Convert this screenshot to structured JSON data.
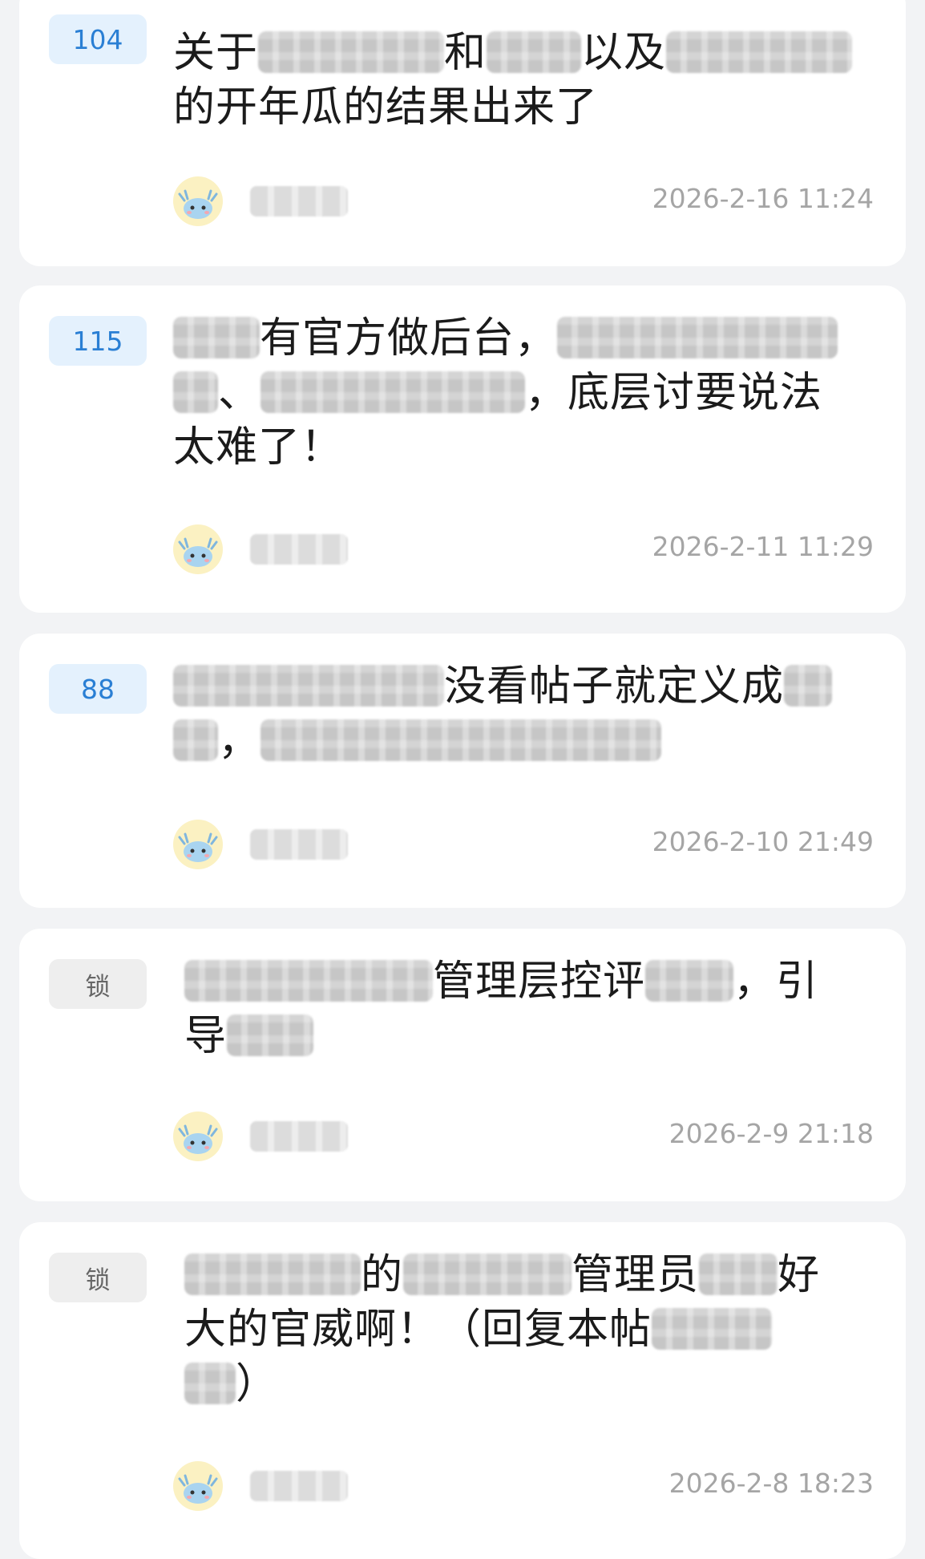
{
  "posts": [
    {
      "badge": "104",
      "badge_type": "count",
      "title_parts": [
        "关于",
        "和",
        "以及",
        "的开年瓜的结果出来了"
      ],
      "time": "2026-2-16 11:24"
    },
    {
      "badge": "115",
      "badge_type": "count",
      "title_parts": [
        "有官方做后台，",
        "，底层讨要说法",
        "太难了！"
      ],
      "time": "2026-2-11 11:29"
    },
    {
      "badge": "88",
      "badge_type": "count",
      "title_parts": [
        "没看帖子就定义成",
        "，"
      ],
      "time": "2026-2-10 21:49"
    },
    {
      "badge": "锁",
      "badge_type": "lock",
      "title_parts": [
        "管理层控评",
        "，引",
        "导"
      ],
      "time": "2026-2-9 21:18"
    },
    {
      "badge": "锁",
      "badge_type": "lock",
      "title_parts": [
        "的",
        "管理员",
        "好",
        "大的官威啊！（回复本帖",
        "）"
      ],
      "time": "2026-2-8 18:23"
    }
  ],
  "colors": {
    "page_bg": "#f2f3f5",
    "card_bg": "#ffffff",
    "count_badge_bg": "#e4f1fd",
    "count_badge_text": "#2a7fd4",
    "lock_badge_bg": "#eeeeee",
    "lock_badge_text": "#666666",
    "time_text": "#a5a5a5"
  },
  "icons": {
    "avatar": "blue-dragon-avatar-icon"
  }
}
